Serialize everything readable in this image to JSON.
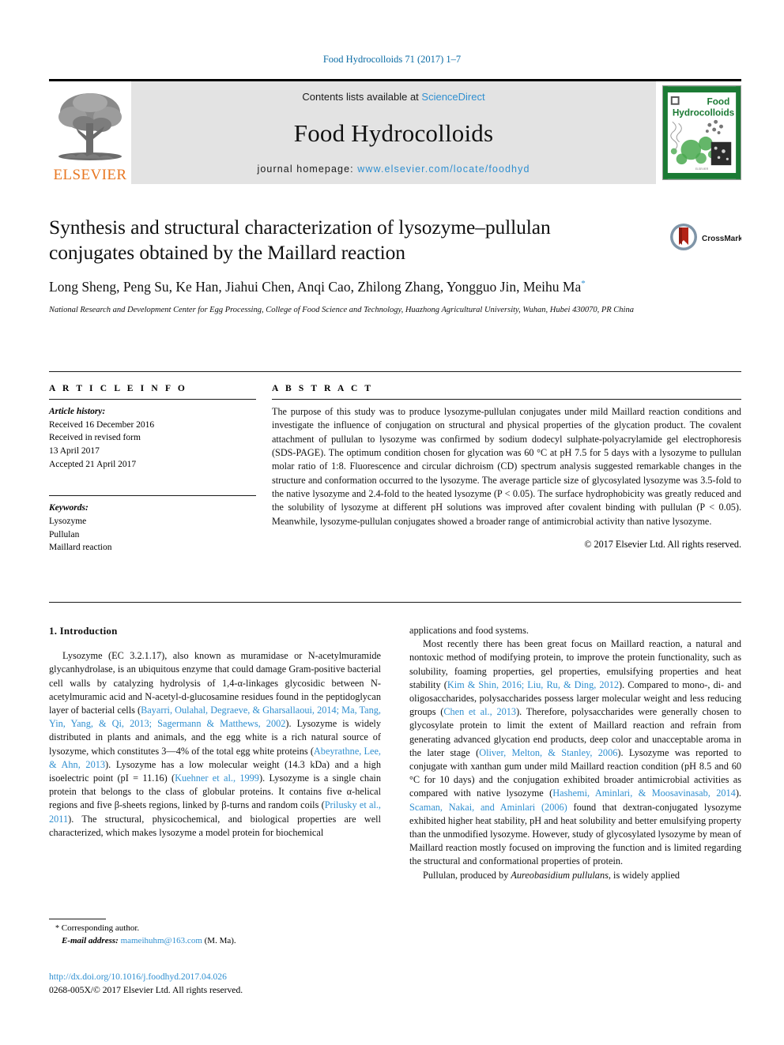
{
  "running_head": "Food Hydrocolloids 71 (2017) 1–7",
  "masthead": {
    "publisher_logo_label": "ELSEVIER",
    "contents_prefix": "Contents lists available at ",
    "contents_link": "ScienceDirect",
    "journal_name": "Food Hydrocolloids",
    "homepage_prefix": "journal homepage: ",
    "homepage_url": "www.elsevier.com/locate/foodhyd",
    "cover_title_line1": "Food",
    "cover_title_line2": "Hydrocolloids"
  },
  "crossmark": {
    "label": "CrossMark"
  },
  "article": {
    "title": "Synthesis and structural characterization of lysozyme–pullulan conjugates obtained by the Maillard reaction",
    "authors": "Long Sheng, Peng Su, Ke Han, Jiahui Chen, Anqi Cao, Zhilong Zhang, Yongguo Jin, Meihu Ma",
    "corresponding_marker": "*",
    "affiliation": "National Research and Development Center for Egg Processing, College of Food Science and Technology, Huazhong Agricultural University, Wuhan, Hubei 430070, PR China"
  },
  "article_info": {
    "heading": "A R T I C L E   I N F O",
    "history_label": "Article history:",
    "history": [
      "Received 16 December 2016",
      "Received in revised form",
      "13 April 2017",
      "Accepted 21 April 2017"
    ],
    "keywords_label": "Keywords:",
    "keywords": [
      "Lysozyme",
      "Pullulan",
      "Maillard reaction"
    ]
  },
  "abstract": {
    "heading": "A B S T R A C T",
    "text": "The purpose of this study was to produce lysozyme-pullulan conjugates under mild Maillard reaction conditions and investigate the influence of conjugation on structural and physical properties of the glycation product. The covalent attachment of pullulan to lysozyme was confirmed by sodium dodecyl sulphate-polyacrylamide gel electrophoresis (SDS-PAGE). The optimum condition chosen for glycation was 60 °C at pH 7.5 for 5 days with a lysozyme to pullulan molar ratio of 1:8. Fluorescence and circular dichroism (CD) spectrum analysis suggested remarkable changes in the structure and conformation occurred to the lysozyme. The average particle size of glycosylated lysozyme was 3.5-fold to the native lysozyme and 2.4-fold to the heated lysozyme (P < 0.05). The surface hydrophobicity was greatly reduced and the solubility of lysozyme at different pH solutions was improved after covalent binding with pullulan (P < 0.05). Meanwhile, lysozyme-pullulan conjugates showed a broader range of antimicrobial activity than native lysozyme.",
    "copyright": "© 2017 Elsevier Ltd. All rights reserved."
  },
  "body": {
    "section_heading": "1. Introduction",
    "left_column": {
      "paragraph_1_part1": "Lysozyme (EC 3.2.1.17), also known as muramidase or N-acetylmuramide glycanhydrolase, is an ubiquitous enzyme that could damage Gram-positive bacterial cell walls by catalyzing hydrolysis of 1,4-α-linkages glycosidic between N-acetylmuramic acid and N-acetyl-d-glucosamine residues found in the peptidoglycan layer of bacterial cells (",
      "citation_1": "Bayarri, Oulahal, Degraeve, & Gharsallaoui, 2014; Ma, Tang, Yin, Yang, & Qi, 2013; Sagermann & Matthews, 2002",
      "paragraph_1_part2": "). Lysozyme is widely distributed in plants and animals, and the egg white is a rich natural source of lysozyme, which constitutes 3—4% of the total egg white proteins (",
      "citation_2": "Abeyrathne, Lee, & Ahn, 2013",
      "paragraph_1_part3": "). Lysozyme has a low molecular weight (14.3 kDa) and a high isoelectric point (pI = 11.16) (",
      "citation_3": "Kuehner et al., 1999",
      "paragraph_1_part4": "). Lysozyme is a single chain protein that belongs to the class of globular proteins. It contains five α-helical regions and five β-sheets regions, linked by β-turns and random coils (",
      "citation_4": "Prilusky et al., 2011",
      "paragraph_1_part5": "). The structural, physicochemical, and biological properties are well characterized, which makes lysozyme a model protein for biochemical"
    },
    "right_column": {
      "continued_line": "applications and food systems.",
      "paragraph_2_part1": "Most recently there has been great focus on Maillard reaction, a natural and nontoxic method of modifying protein, to improve the protein functionality, such as solubility, foaming properties, gel properties, emulsifying properties and heat stability (",
      "citation_5": "Kim & Shin, 2016; Liu, Ru, & Ding, 2012",
      "paragraph_2_part2": "). Compared to mono-, di- and oligosaccharides, polysaccharides possess larger molecular weight and less reducing groups (",
      "citation_6": "Chen et al., 2013",
      "paragraph_2_part3": "). Therefore, polysaccharides were generally chosen to glycosylate protein to limit the extent of Maillard reaction and refrain from generating advanced glycation end products, deep color and unacceptable aroma in the later stage (",
      "citation_7": "Oliver, Melton, & Stanley, 2006",
      "paragraph_2_part4": "). Lysozyme was reported to conjugate with xanthan gum under mild Maillard reaction condition (pH 8.5 and 60 °C for 10 days) and the conjugation exhibited broader antimicrobial activities as compared with native lysozyme (",
      "citation_8": "Hashemi, Aminlari, & Moosavinasab, 2014",
      "paragraph_2_part5": "). ",
      "citation_9": "Scaman, Nakai, and Aminlari (2006)",
      "paragraph_2_part6": " found that dextran-conjugated lysozyme exhibited higher heat stability, pH and heat solubility and better emulsifying property than the unmodified lysozyme. However, study of glycosylated lysozyme by mean of Maillard reaction mostly focused on improving the function and is limited regarding the structural and conformational properties of protein.",
      "paragraph_3_part1": "Pullulan, produced by ",
      "paragraph_3_italic": "Aureobasidium pullulans",
      "paragraph_3_part2": ", is widely applied"
    }
  },
  "footnote": {
    "corresponding_marker": "*",
    "corresponding_text": "Corresponding author.",
    "email_label": "E-mail address:",
    "email": "mameihuhm@163.com",
    "email_suffix": "(M. Ma)."
  },
  "footer": {
    "doi": "http://dx.doi.org/10.1016/j.foodhyd.2017.04.026",
    "issn_line": "0268-005X/© 2017 Elsevier Ltd. All rights reserved."
  },
  "colors": {
    "link_blue": "#2f8fd0",
    "running_head_blue": "#0b6ca5",
    "elsevier_orange": "#e87722",
    "banner_gray": "#e3e3e3",
    "cover_green": "#1b7a34"
  }
}
